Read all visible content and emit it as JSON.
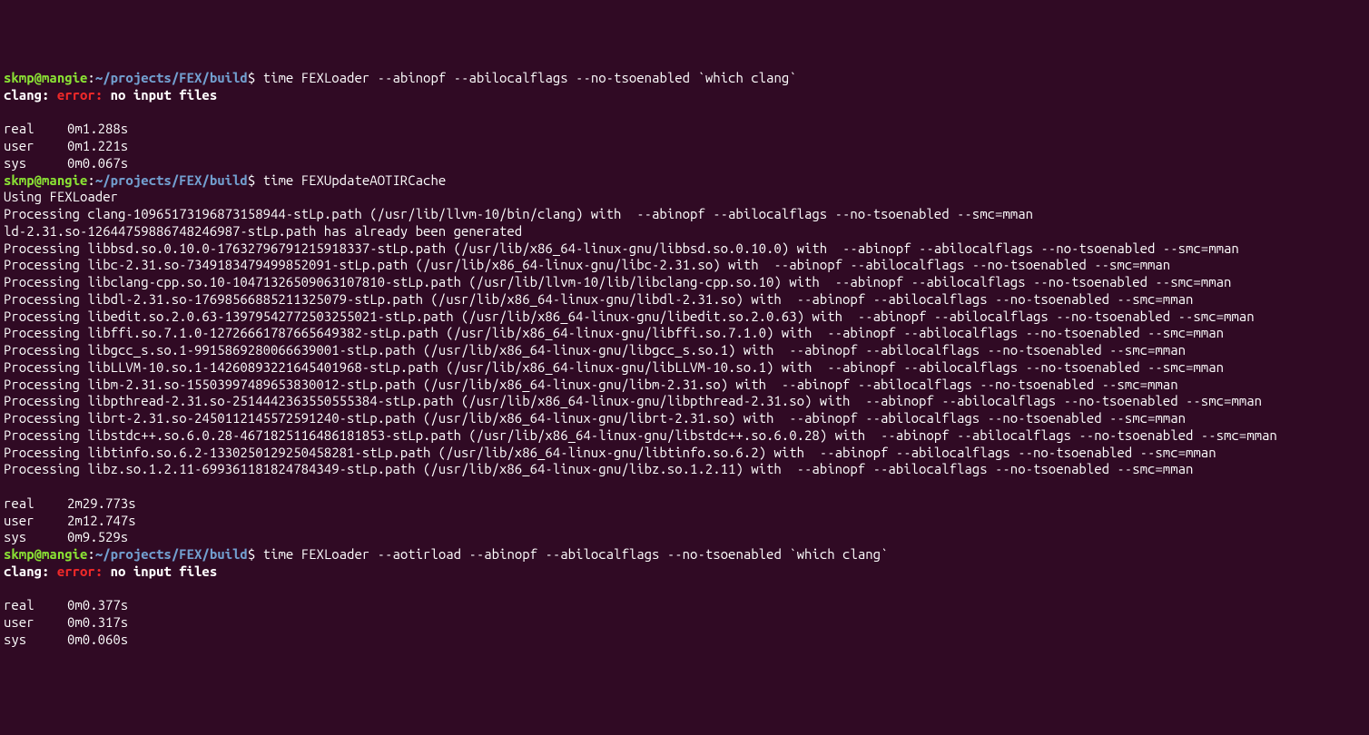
{
  "prompt": {
    "user": "skmp",
    "at": "@",
    "host": "mangie",
    "colon": ":",
    "path": "~/projects/FEX/build",
    "dollar": "$"
  },
  "block1": {
    "cmd": " time FEXLoader --abinopf --abilocalflags --no-tsoenabled `which clang`",
    "clang_prefix": "clang: ",
    "error_label": "error:",
    "error_msg": " no input files",
    "times": {
      "real_label": "real",
      "real_value": "0m1.288s",
      "user_label": "user",
      "user_value": "0m1.221s",
      "sys_label": "sys",
      "sys_value": "0m0.067s"
    }
  },
  "block2": {
    "cmd": " time FEXUpdateAOTIRCache",
    "using": "Using FEXLoader",
    "lines": [
      "Processing clang-10965173196873158944-stLp.path (/usr/lib/llvm-10/bin/clang) with  --abinopf --abilocalflags --no-tsoenabled --smc=mman",
      "ld-2.31.so-12644759886748246987-stLp.path has already been generated",
      "Processing libbsd.so.0.10.0-17632796791215918337-stLp.path (/usr/lib/x86_64-linux-gnu/libbsd.so.0.10.0) with  --abinopf --abilocalflags --no-tsoenabled --smc=mman",
      "Processing libc-2.31.so-7349183479499852091-stLp.path (/usr/lib/x86_64-linux-gnu/libc-2.31.so) with  --abinopf --abilocalflags --no-tsoenabled --smc=mman",
      "Processing libclang-cpp.so.10-10471326509063107810-stLp.path (/usr/lib/llvm-10/lib/libclang-cpp.so.10) with  --abinopf --abilocalflags --no-tsoenabled --smc=mman",
      "Processing libdl-2.31.so-17698566885211325079-stLp.path (/usr/lib/x86_64-linux-gnu/libdl-2.31.so) with  --abinopf --abilocalflags --no-tsoenabled --smc=mman",
      "Processing libedit.so.2.0.63-13979542772503255021-stLp.path (/usr/lib/x86_64-linux-gnu/libedit.so.2.0.63) with  --abinopf --abilocalflags --no-tsoenabled --smc=mman",
      "Processing libffi.so.7.1.0-12726661787665649382-stLp.path (/usr/lib/x86_64-linux-gnu/libffi.so.7.1.0) with  --abinopf --abilocalflags --no-tsoenabled --smc=mman",
      "Processing libgcc_s.so.1-9915869280066639001-stLp.path (/usr/lib/x86_64-linux-gnu/libgcc_s.so.1) with  --abinopf --abilocalflags --no-tsoenabled --smc=mman",
      "Processing libLLVM-10.so.1-14260893221645401968-stLp.path (/usr/lib/x86_64-linux-gnu/libLLVM-10.so.1) with  --abinopf --abilocalflags --no-tsoenabled --smc=mman",
      "Processing libm-2.31.so-15503997489653830012-stLp.path (/usr/lib/x86_64-linux-gnu/libm-2.31.so) with  --abinopf --abilocalflags --no-tsoenabled --smc=mman",
      "Processing libpthread-2.31.so-2514442363550555384-stLp.path (/usr/lib/x86_64-linux-gnu/libpthread-2.31.so) with  --abinopf --abilocalflags --no-tsoenabled --smc=mman",
      "Processing librt-2.31.so-2450112145572591240-stLp.path (/usr/lib/x86_64-linux-gnu/librt-2.31.so) with  --abinopf --abilocalflags --no-tsoenabled --smc=mman",
      "Processing libstdc++.so.6.0.28-4671825116486181853-stLp.path (/usr/lib/x86_64-linux-gnu/libstdc++.so.6.0.28) with  --abinopf --abilocalflags --no-tsoenabled --smc=mman",
      "Processing libtinfo.so.6.2-1330250129250458281-stLp.path (/usr/lib/x86_64-linux-gnu/libtinfo.so.6.2) with  --abinopf --abilocalflags --no-tsoenabled --smc=mman",
      "Processing libz.so.1.2.11-699361181824784349-stLp.path (/usr/lib/x86_64-linux-gnu/libz.so.1.2.11) with  --abinopf --abilocalflags --no-tsoenabled --smc=mman"
    ],
    "times": {
      "real_label": "real",
      "real_value": "2m29.773s",
      "user_label": "user",
      "user_value": "2m12.747s",
      "sys_label": "sys",
      "sys_value": "0m9.529s"
    }
  },
  "block3": {
    "cmd": " time FEXLoader --aotirload --abinopf --abilocalflags --no-tsoenabled `which clang`",
    "clang_prefix": "clang: ",
    "error_label": "error:",
    "error_msg": " no input files",
    "times": {
      "real_label": "real",
      "real_value": "0m0.377s",
      "user_label": "user",
      "user_value": "0m0.317s",
      "sys_label": "sys",
      "sys_value": "0m0.060s"
    }
  }
}
